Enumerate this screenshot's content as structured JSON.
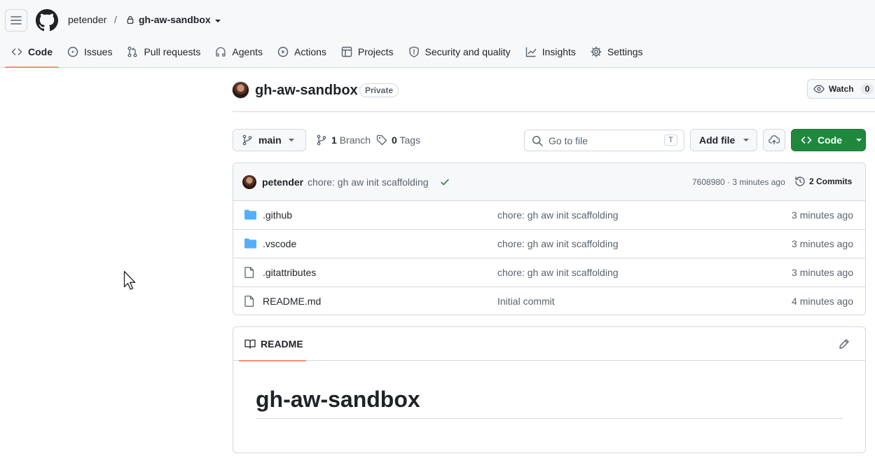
{
  "header": {
    "owner": "petender",
    "separator": "/",
    "repo": "gh-aw-sandbox"
  },
  "tabs": [
    {
      "label": "Code",
      "icon": "code-icon",
      "active": true
    },
    {
      "label": "Issues",
      "icon": "issue-opened-icon"
    },
    {
      "label": "Pull requests",
      "icon": "git-pull-request-icon"
    },
    {
      "label": "Agents",
      "icon": "agent-icon"
    },
    {
      "label": "Actions",
      "icon": "play-icon"
    },
    {
      "label": "Projects",
      "icon": "table-icon"
    },
    {
      "label": "Security and quality",
      "icon": "shield-icon"
    },
    {
      "label": "Insights",
      "icon": "graph-icon"
    },
    {
      "label": "Settings",
      "icon": "gear-icon"
    }
  ],
  "repo_header": {
    "title": "gh-aw-sandbox",
    "visibility": "Private",
    "watch_label": "Watch",
    "watch_count": "0"
  },
  "toolbar": {
    "branch": "main",
    "branch_count": "1",
    "branch_label": "Branch",
    "tag_count": "0",
    "tag_label": "Tags",
    "goto_placeholder": "Go to file",
    "goto_shortcut": "T",
    "add_file": "Add file",
    "code": "Code"
  },
  "latest_commit": {
    "author": "petender",
    "message": "chore: gh aw init scaffolding",
    "meta": "7608980 · 3 minutes ago",
    "commits_label": "2 Commits"
  },
  "files": [
    {
      "name": ".github",
      "type": "folder",
      "message": "chore: gh aw init scaffolding",
      "time": "3 minutes ago"
    },
    {
      "name": ".vscode",
      "type": "folder",
      "message": "chore: gh aw init scaffolding",
      "time": "3 minutes ago"
    },
    {
      "name": ".gitattributes",
      "type": "file",
      "message": "chore: gh aw init scaffolding",
      "time": "3 minutes ago"
    },
    {
      "name": "README.md",
      "type": "file",
      "message": "Initial commit",
      "time": "4 minutes ago"
    }
  ],
  "readme": {
    "tab_label": "README",
    "heading": "gh-aw-sandbox"
  },
  "colors": {
    "accent_underline": "#fd8c73",
    "code_button": "#1f883d",
    "folder": "#54aeff",
    "check": "#1a7f37"
  }
}
